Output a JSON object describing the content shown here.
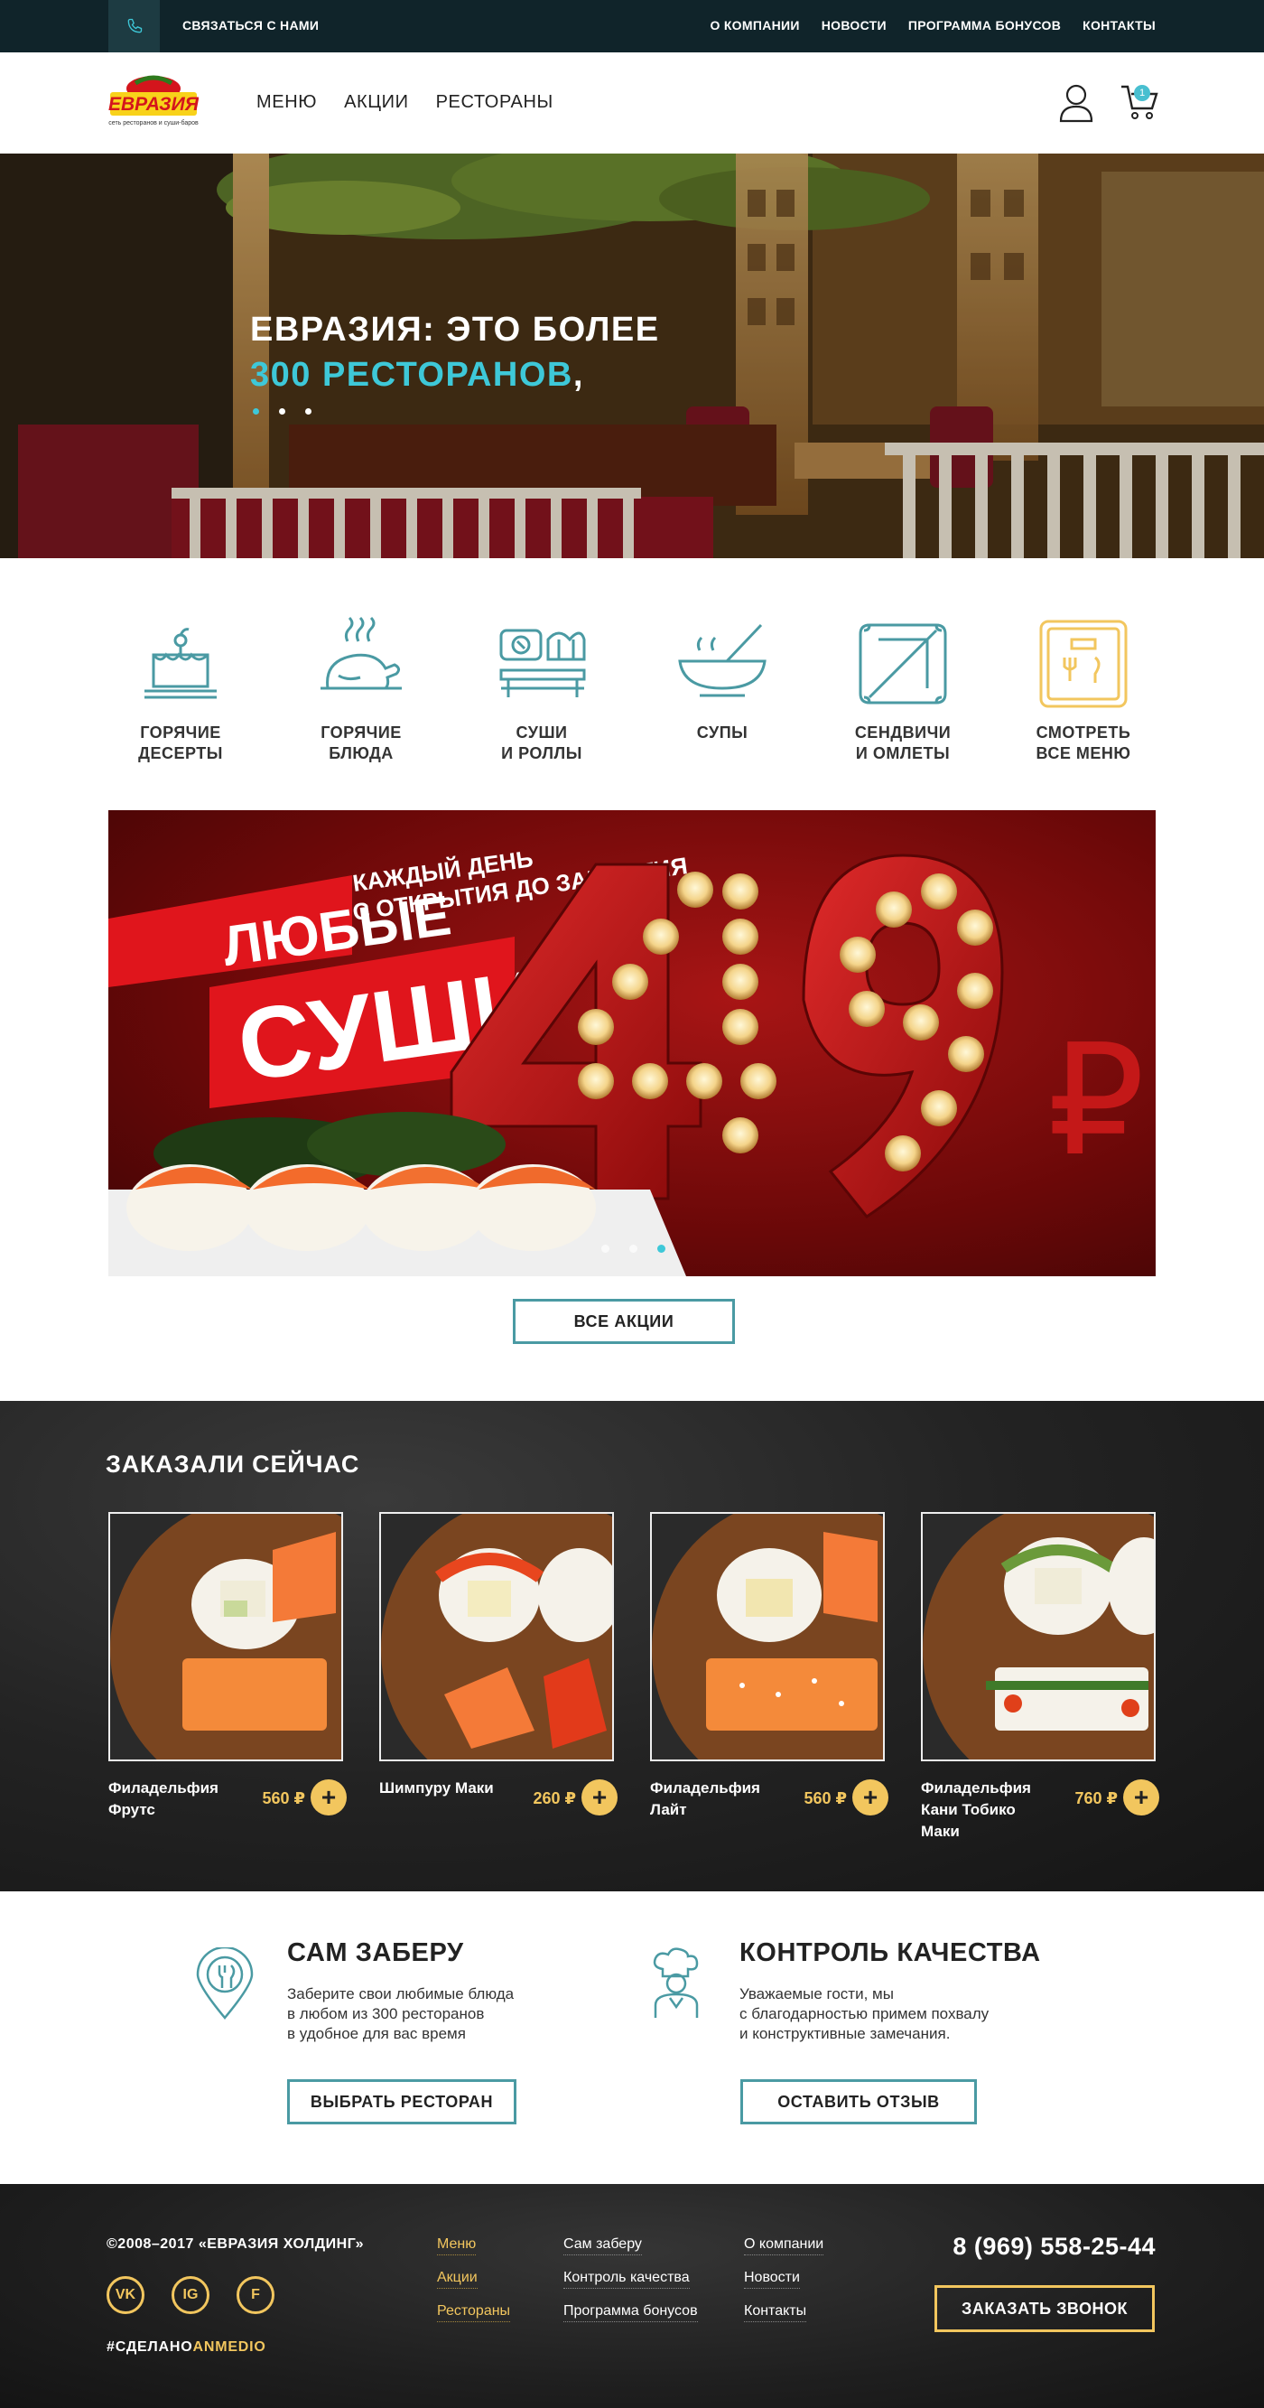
{
  "topbar": {
    "contact_label": "СВЯЗАТЬСЯ С НАМИ",
    "links": [
      "О КОМПАНИИ",
      "НОВОСТИ",
      "ПРОГРАММА БОНУСОВ",
      "КОНТАКТЫ"
    ]
  },
  "header": {
    "logo_text": "ЕВРАЗИЯ",
    "logo_tagline": "сеть ресторанов и суши-баров",
    "nav": [
      "МЕНЮ",
      "АКЦИИ",
      "РЕСТОРАНЫ"
    ],
    "cart_count": "1"
  },
  "hero": {
    "title_line1": "ЕВРАЗИЯ: ЭТО БОЛЕЕ",
    "title_line2": "300 РЕСТОРАНОВ",
    "title_line2_tail": ","
  },
  "categories": [
    {
      "label": "ГОРЯЧИЕ\nДЕСЕРТЫ",
      "icon": "dessert-icon"
    },
    {
      "label": "ГОРЯЧИЕ\nБЛЮДА",
      "icon": "roast-chicken-icon"
    },
    {
      "label": "СУШИ\nИ РОЛЛЫ",
      "icon": "sushi-icon"
    },
    {
      "label": "СУПЫ",
      "icon": "soup-bowl-icon"
    },
    {
      "label": "СЕНДВИЧИ\nИ ОМЛЕТЫ",
      "icon": "sandwich-icon"
    },
    {
      "label": "СМОТРЕТЬ\nВСЕ МЕНЮ",
      "icon": "menu-book-icon"
    }
  ],
  "promo": {
    "word1": "ЛЮБЫЕ",
    "word2": "СУШИ",
    "sub_line1": "КАЖДЫЙ ДЕНЬ",
    "sub_line2": "С ОТКРЫТИЯ ДО ЗАКРЫТИЯ",
    "price": "49",
    "currency": "₽",
    "all_button": "ВСЕ АКЦИИ"
  },
  "ordered": {
    "title": "ЗАКАЗАЛИ СЕЙЧАС",
    "items": [
      {
        "name": "Филадельфия Фрутс",
        "price": "560 ₽"
      },
      {
        "name": "Шимпуру Маки",
        "price": "260 ₽"
      },
      {
        "name": "Филадельфия Лайт",
        "price": "560 ₽"
      },
      {
        "name": "Филадельфия Кани Тобико Маки",
        "price": "760 ₽"
      }
    ],
    "add_symbol": "+"
  },
  "services": [
    {
      "title": "САМ ЗАБЕРУ",
      "text": "Заберите свои любимые блюда\nв любом из 300 ресторанов\nв удобное для вас время",
      "button": "ВЫБРАТЬ РЕСТОРАН"
    },
    {
      "title": "КОНТРОЛЬ КАЧЕСТВА",
      "text": "Уважаемые гости, мы\nс благодарностью примем похвалу\nи конструктивные замечания.",
      "button": "ОСТАВИТЬ ОТЗЫВ"
    }
  ],
  "footer": {
    "copyright": "©2008–2017 «ЕВРАЗИЯ ХОЛДИНГ»",
    "social": [
      "VK",
      "IG",
      "F"
    ],
    "hashtag_prefix": "#СДЕЛАНО",
    "hashtag_suffix": "ANMEDIO",
    "col1": [
      "Меню",
      "Акции",
      "Рестораны"
    ],
    "col2": [
      "Сам заберу",
      "Контроль качества",
      "Программа бонусов"
    ],
    "col3": [
      "О компании",
      "Новости",
      "Контакты"
    ],
    "phone": "8 (969) 558-25-44",
    "call_button": "ЗАКАЗАТЬ ЗВОНОК"
  },
  "colors": {
    "accent": "#3ec8d8",
    "gold": "#f2c65e",
    "teal_icon": "#4a9aa3",
    "dark": "#10242a",
    "red": "#d4151c"
  }
}
